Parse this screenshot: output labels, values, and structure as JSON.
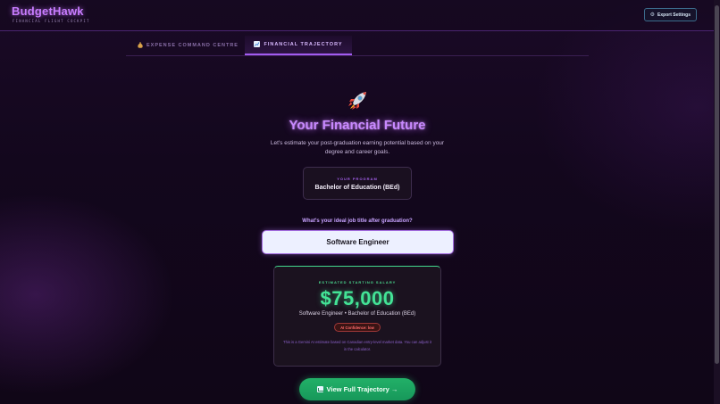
{
  "app": {
    "name": "BudgetHawk",
    "tagline": "FINANCIAL FLIGHT COCKPIT"
  },
  "header": {
    "export_label": "Export Settings",
    "export_icon": "gear-icon"
  },
  "tabs": [
    {
      "label": "EXPENSE COMMAND CENTRE",
      "icon": "money-bag-icon",
      "active": false
    },
    {
      "label": "FINANCIAL TRAJECTORY",
      "icon": "chart-icon",
      "active": true
    }
  ],
  "main": {
    "hero_icon": "rocket-icon",
    "title": "Your Financial Future",
    "subtitle": "Let's estimate your post-graduation earning potential based on your degree and career goals.",
    "program": {
      "label": "YOUR PROGRAM",
      "value": "Bachelor of Education (BEd)"
    },
    "job_question": "What's your ideal job title after graduation?",
    "job_input": {
      "value": "Software Engineer",
      "placeholder": ""
    },
    "salary": {
      "label": "ESTIMATED STARTING SALARY",
      "amount": "$75,000",
      "detail": "Software Engineer • Bachelor of Education (BEd)",
      "confidence": "AI Confidence: low",
      "note": "This is a Gemini AI estimate based on Canadian entry-level market data. You can adjust it in the calculator."
    },
    "cta_label": "View Full Trajectory →"
  },
  "colors": {
    "accent_purple": "#c889ff",
    "accent_green": "#43e396",
    "confidence_red": "#ff6b6b",
    "background": "#12071c"
  }
}
